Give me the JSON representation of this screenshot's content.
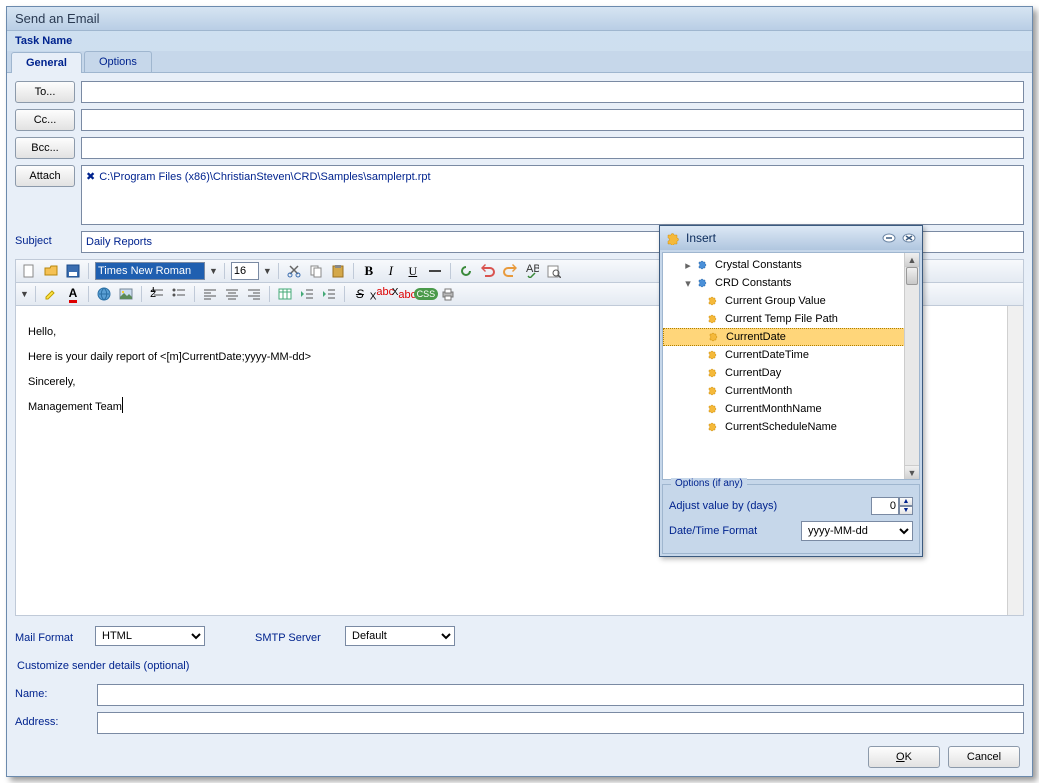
{
  "window": {
    "title": "Send an Email",
    "task_name_label": "Task Name"
  },
  "tabs": {
    "general": "General",
    "options": "Options"
  },
  "buttons": {
    "to": "To...",
    "cc": "Cc...",
    "bcc": "Bcc...",
    "attach": "Attach",
    "ok": "OK",
    "cancel": "Cancel"
  },
  "fields": {
    "to": "",
    "cc": "",
    "bcc": "",
    "attachment": "C:\\Program Files (x86)\\ChristianSteven\\CRD\\Samples\\samplerpt.rpt",
    "subject_label": "Subject",
    "subject": "Daily Reports",
    "mail_format_label": "Mail Format",
    "mail_format": "HTML",
    "smtp_label": "SMTP Server",
    "smtp": "Default",
    "customize_label": "Customize sender details (optional)",
    "name_label": "Name:",
    "name": "",
    "address_label": "Address:",
    "address": ""
  },
  "editor": {
    "font": "Times New Roman",
    "size": "16",
    "body_line1": "Hello,",
    "body_line2": "Here is your daily report of <[m]CurrentDate;yyyy-MM-dd>",
    "body_line3": "Sincerely,",
    "body_line4": "Management Team"
  },
  "insert_popup": {
    "title": "Insert",
    "nodes": {
      "crystal": "Crystal Constants",
      "crd": "CRD Constants",
      "items": [
        "Current Group Value",
        "Current Temp File Path",
        "CurrentDate",
        "CurrentDateTime",
        "CurrentDay",
        "CurrentMonth",
        "CurrentMonthName",
        "CurrentScheduleName"
      ]
    },
    "options_label": "Options (if any)",
    "adjust_label": "Adjust value by (days)",
    "adjust_value": "0",
    "format_label": "Date/Time Format",
    "format_value": "yyyy-MM-dd"
  }
}
